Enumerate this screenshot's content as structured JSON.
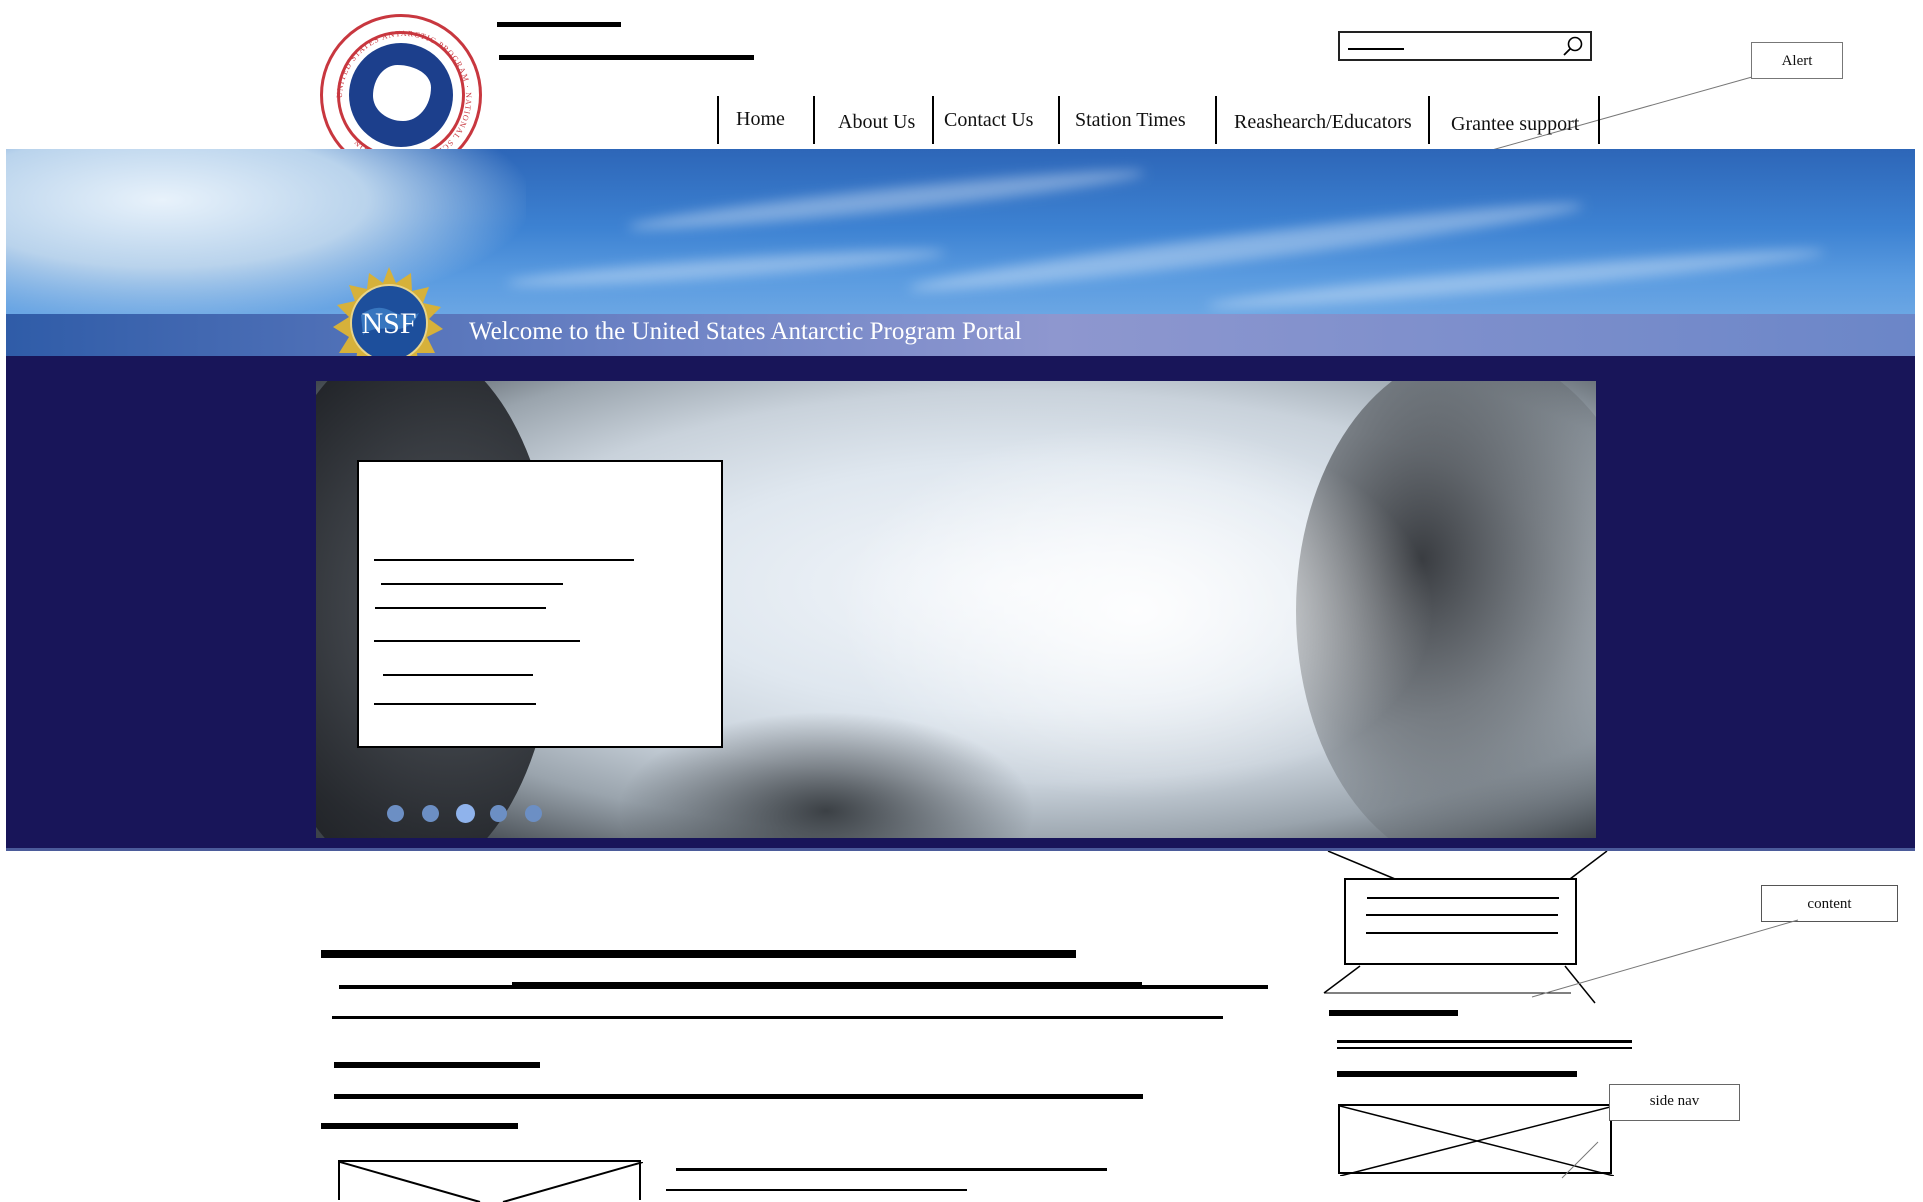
{
  "header": {
    "logo_name": "united-states-antarctic-program-seal",
    "logo_text": "UNITED STATES ANTARCTIC PROGRAM · NATIONAL SCIENCE FOUNDATION",
    "search": {
      "placeholder": "",
      "icon": "search-icon"
    },
    "annotation_alert": "Alert"
  },
  "nav": {
    "items": [
      {
        "label": "Home"
      },
      {
        "label": "About Us"
      },
      {
        "label": "Contact Us"
      },
      {
        "label": "Station Times"
      },
      {
        "label": "Reashearch/Educators"
      },
      {
        "label": "Grantee support"
      }
    ]
  },
  "banner": {
    "welcome_text": "Welcome to the United States Antarctic Program Portal",
    "nsf_logo_text": "NSF"
  },
  "hero": {
    "slides_count": 5,
    "active_slide": 3
  },
  "annotations": {
    "content": "content",
    "side_nav": "side nav"
  },
  "colors": {
    "hero_background": "#181559",
    "seal_red": "#c8373f",
    "seal_blue": "#1c3f8c",
    "nsf_gold": "#d6b13a",
    "banner_blue": "#3d82d2"
  }
}
